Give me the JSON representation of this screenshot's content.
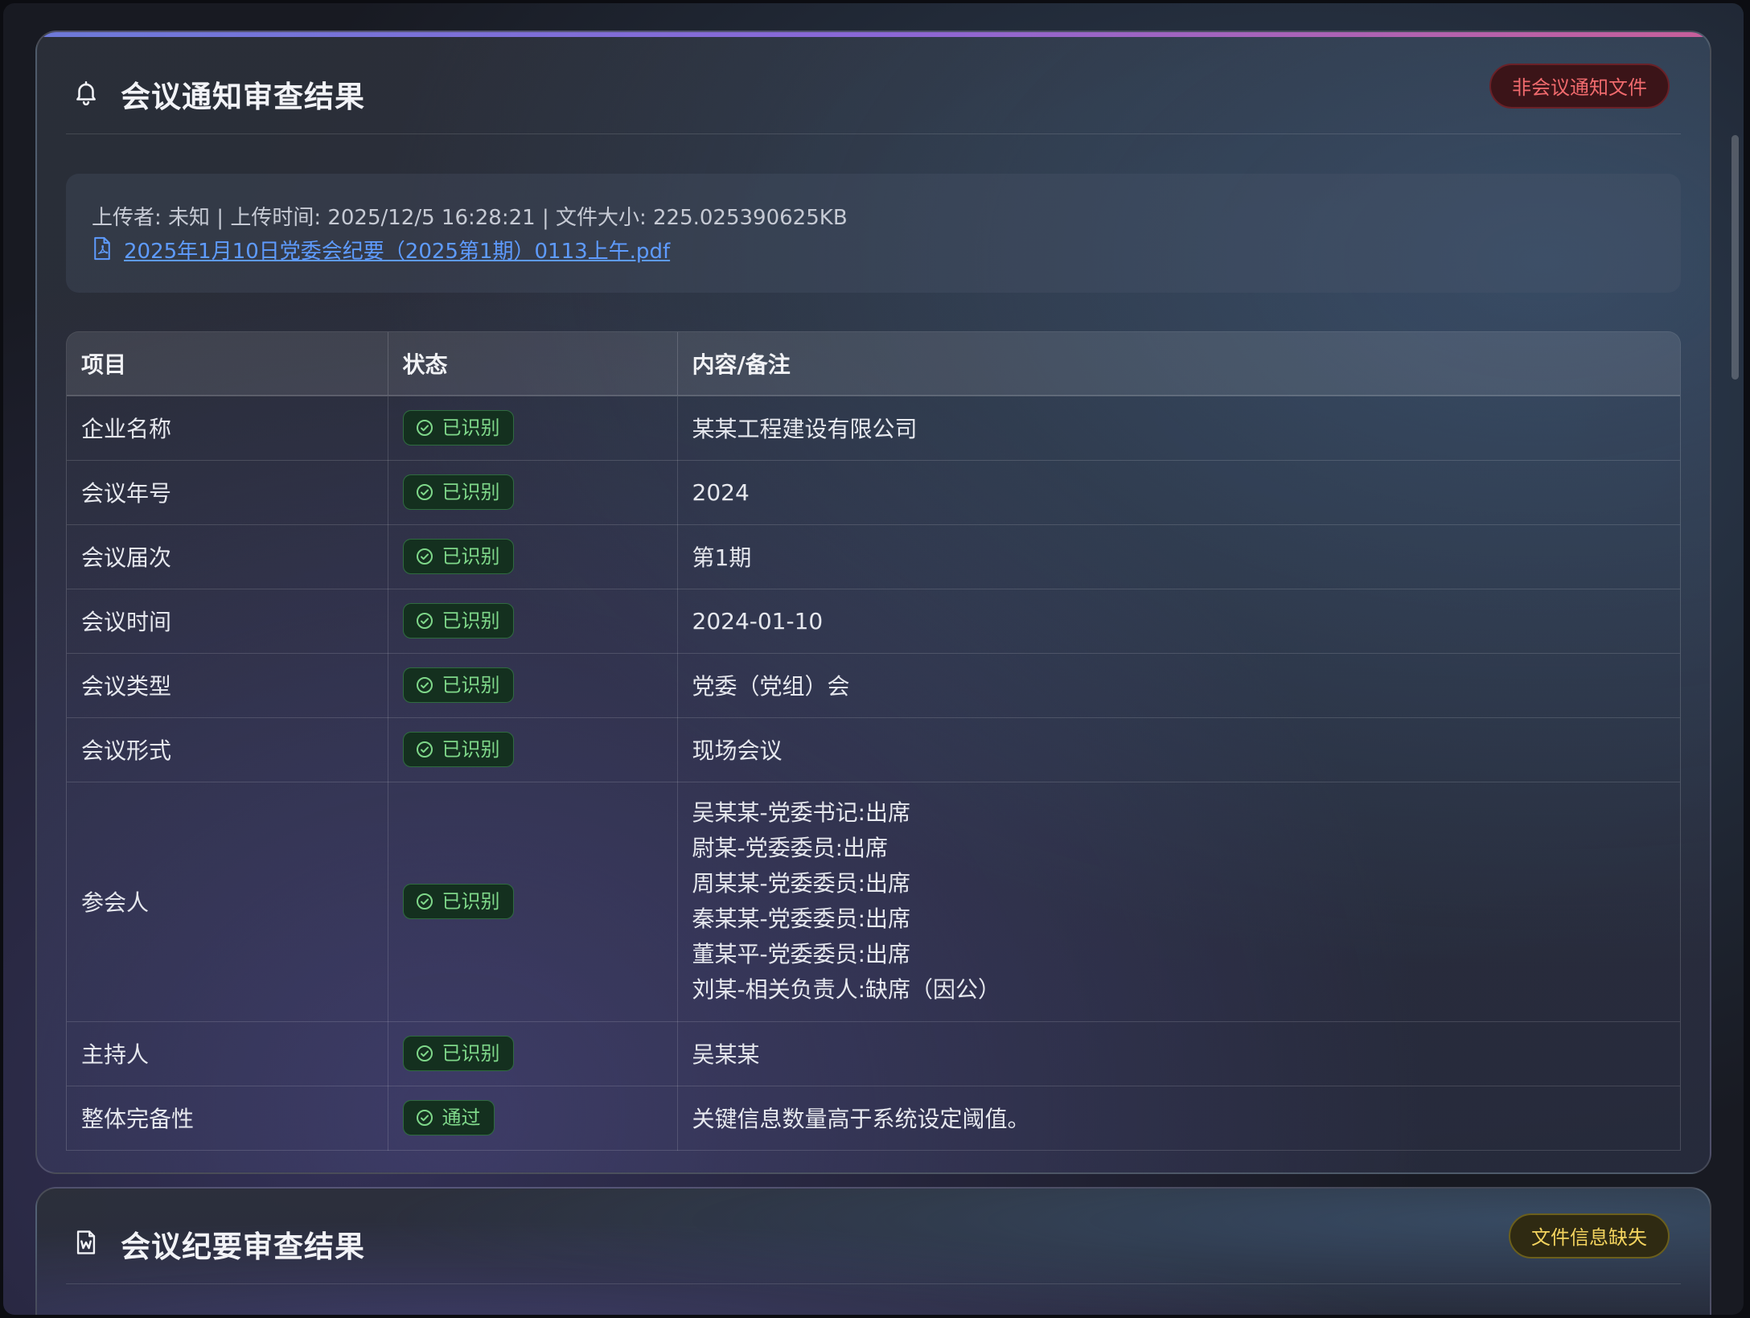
{
  "notice_card": {
    "title": "会议通知审查结果",
    "header_icon": "bell-icon",
    "badge": "非会议通知文件",
    "file_meta": "上传者: 未知 | 上传时间: 2025/12/5 16:28:21 | 文件大小: 225.025390625KB",
    "file_icon": "pdf-file-icon",
    "file_name": "2025年1月10日党委会纪要（2025第1期）0113上午.pdf",
    "table": {
      "headers": [
        "项目",
        "状态",
        "内容/备注"
      ],
      "rows": [
        {
          "item": "企业名称",
          "status": "已识别",
          "content": "某某工程建设有限公司"
        },
        {
          "item": "会议年号",
          "status": "已识别",
          "content": "2024"
        },
        {
          "item": "会议届次",
          "status": "已识别",
          "content": "第1期"
        },
        {
          "item": "会议时间",
          "status": "已识别",
          "content": "2024-01-10"
        },
        {
          "item": "会议类型",
          "status": "已识别",
          "content": "党委（党组）会"
        },
        {
          "item": "会议形式",
          "status": "已识别",
          "content": "现场会议"
        },
        {
          "item": "参会人",
          "status": "已识别",
          "attendees": [
            "吴某某-党委书记:出席",
            "尉某-党委委员:出席",
            "周某某-党委委员:出席",
            "秦某某-党委委员:出席",
            "董某平-党委委员:出席",
            "刘某-相关负责人:缺席（因公）"
          ]
        },
        {
          "item": "主持人",
          "status": "已识别",
          "content": "吴某某"
        },
        {
          "item": "整体完备性",
          "status": "通过",
          "content": "关键信息数量高于系统设定阈值。"
        }
      ]
    }
  },
  "minutes_card": {
    "title": "会议纪要审查结果",
    "header_icon": "word-document-icon",
    "badge": "文件信息缺失"
  },
  "colors": {
    "status_green": "#7fd88a",
    "badge_red": "#f06a6d",
    "badge_yellow": "#f3d35e",
    "link_blue": "#5e9bff"
  }
}
